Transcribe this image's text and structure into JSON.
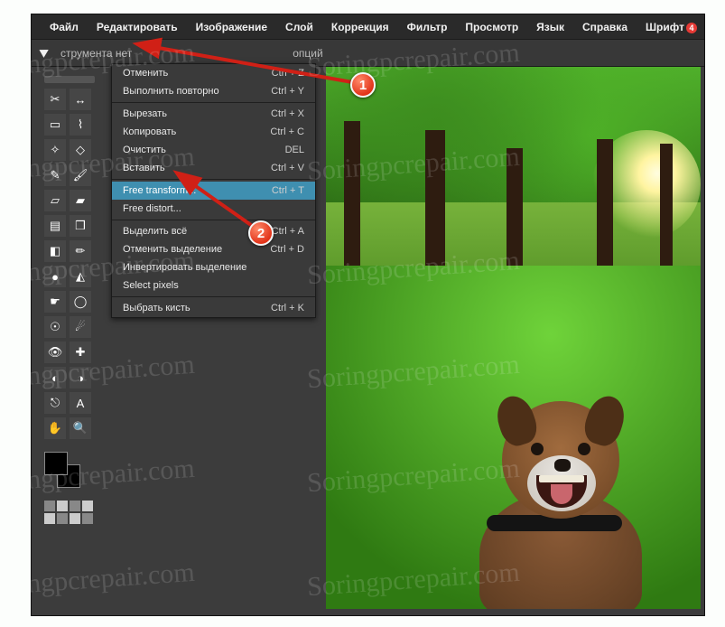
{
  "menubar": {
    "items": [
      "Файл",
      "Редактировать",
      "Изображение",
      "Слой",
      "Коррекция",
      "Фильтр",
      "Просмотр",
      "Язык",
      "Справка",
      "Шрифт"
    ],
    "font_badge": "4"
  },
  "optbar": {
    "text_fragment": "струмента нет",
    "options_label": "опций"
  },
  "edit_menu": {
    "groups": [
      [
        {
          "label": "Отменить",
          "shortcut": "Ctrl + Z"
        },
        {
          "label": "Выполнить повторно",
          "shortcut": "Ctrl + Y"
        }
      ],
      [
        {
          "label": "Вырезать",
          "shortcut": "Ctrl + X"
        },
        {
          "label": "Копировать",
          "shortcut": "Ctrl + C"
        },
        {
          "label": "Очистить",
          "shortcut": "DEL"
        },
        {
          "label": "Вставить",
          "shortcut": "Ctrl + V"
        }
      ],
      [
        {
          "label": "Free transform...",
          "shortcut": "Ctrl + T",
          "highlight": true
        },
        {
          "label": "Free distort...",
          "shortcut": ""
        }
      ],
      [
        {
          "label": "Выделить всё",
          "shortcut": "Ctrl + A"
        },
        {
          "label": "Отменить выделение",
          "shortcut": "Ctrl + D"
        },
        {
          "label": "Инвертировать выделение",
          "shortcut": ""
        },
        {
          "label": "Select pixels",
          "shortcut": ""
        }
      ],
      [
        {
          "label": "Выбрать кисть",
          "shortcut": "Ctrl + K"
        }
      ]
    ]
  },
  "tools": [
    "crop-icon",
    "move-icon",
    "marquee-icon",
    "lasso-icon",
    "wand-icon",
    "lasso-poly-icon",
    "pencil-icon",
    "brush-icon",
    "eraser-icon",
    "bucket-icon",
    "gradient-icon",
    "clone-icon",
    "replace-color-icon",
    "draw-icon",
    "blur-icon",
    "sharpen-icon",
    "smudge-icon",
    "sponge-icon",
    "dodge-icon",
    "burn-icon",
    "redeye-icon",
    "spot-heal-icon",
    "bloat-icon",
    "pinch-icon",
    "picker-icon",
    "type-icon",
    "hand-icon",
    "zoom-icon"
  ],
  "tool_glyphs": {
    "crop-icon": "✂",
    "move-icon": "↔",
    "marquee-icon": "▭",
    "lasso-icon": "⌇",
    "wand-icon": "✧",
    "lasso-poly-icon": "◇",
    "pencil-icon": "✎",
    "brush-icon": "🖌",
    "eraser-icon": "▱",
    "bucket-icon": "▰",
    "gradient-icon": "▤",
    "clone-icon": "❒",
    "replace-color-icon": "◧",
    "draw-icon": "✏",
    "blur-icon": "●",
    "sharpen-icon": "◭",
    "smudge-icon": "☛",
    "sponge-icon": "◯",
    "dodge-icon": "☉",
    "burn-icon": "☄",
    "redeye-icon": "👁",
    "spot-heal-icon": "✚",
    "bloat-icon": "◐",
    "pinch-icon": "◑",
    "picker-icon": "⎋",
    "type-icon": "A",
    "hand-icon": "✋",
    "zoom-icon": "🔍"
  },
  "callouts": {
    "one": "1",
    "two": "2"
  },
  "watermark": "Soringpcrepair.com"
}
